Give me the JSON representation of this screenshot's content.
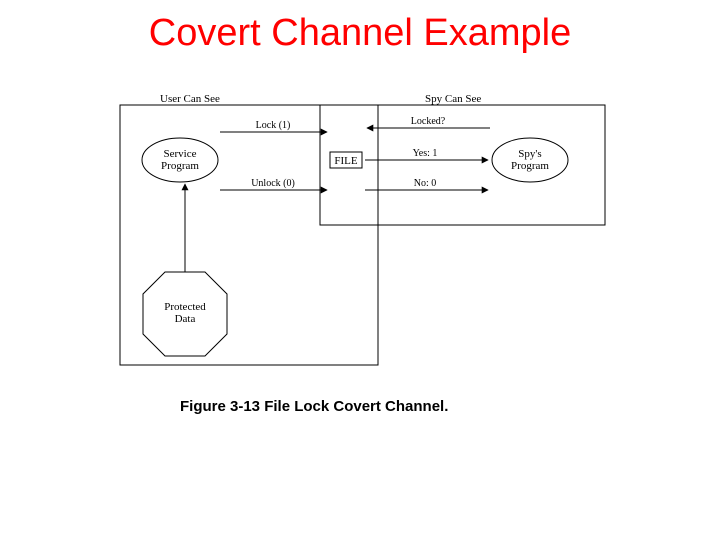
{
  "title": "Covert Channel Example",
  "caption": "Figure 3-13  File Lock Covert Channel.",
  "diagram": {
    "left_panel_label": "User Can See",
    "right_panel_label": "Spy Can See",
    "service_program": {
      "line1": "Service",
      "line2": "Program"
    },
    "spys_program": {
      "line1": "Spy's",
      "line2": "Program"
    },
    "file_box": "FILE",
    "lock_arrow": "Lock (1)",
    "unlock_arrow": "Unlock (0)",
    "locked_query": "Locked?",
    "yes_label": "Yes:   1",
    "no_label": "No:   0",
    "protected_data": {
      "line1": "Protected",
      "line2": "Data"
    }
  }
}
